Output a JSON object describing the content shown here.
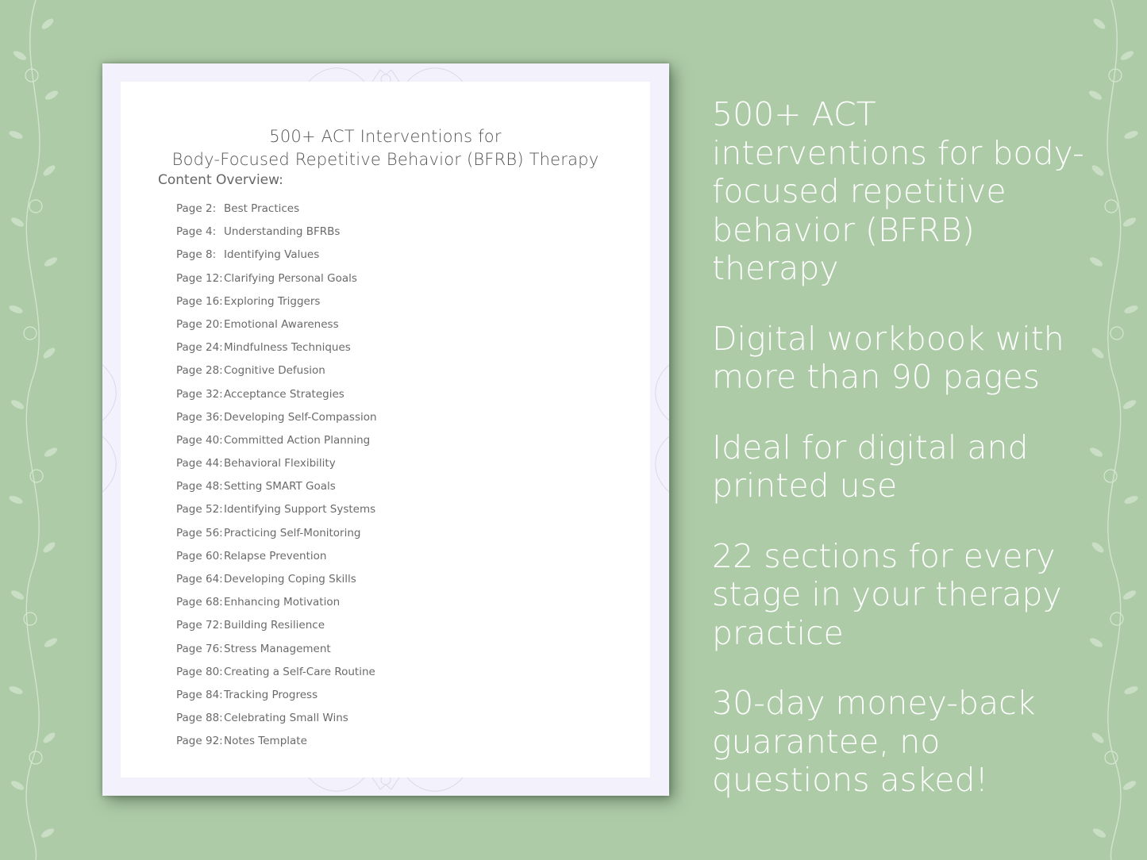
{
  "document": {
    "title_line1": "500+ ACT Interventions for",
    "title_line2": "Body-Focused Repetitive Behavior (BFRB) Therapy",
    "overview_label": "Content Overview:",
    "toc": [
      {
        "page": "Page  2:",
        "label": "Best Practices"
      },
      {
        "page": "Page  4:",
        "label": "Understanding BFRBs"
      },
      {
        "page": "Page  8:",
        "label": "Identifying Values"
      },
      {
        "page": "Page 12:",
        "label": "Clarifying Personal Goals"
      },
      {
        "page": "Page 16:",
        "label": "Exploring Triggers"
      },
      {
        "page": "Page 20:",
        "label": "Emotional Awareness"
      },
      {
        "page": "Page 24:",
        "label": "Mindfulness Techniques"
      },
      {
        "page": "Page 28:",
        "label": "Cognitive Defusion"
      },
      {
        "page": "Page 32:",
        "label": "Acceptance Strategies"
      },
      {
        "page": "Page 36:",
        "label": "Developing Self-Compassion"
      },
      {
        "page": "Page 40:",
        "label": "Committed Action Planning"
      },
      {
        "page": "Page 44:",
        "label": "Behavioral Flexibility"
      },
      {
        "page": "Page 48:",
        "label": "Setting SMART Goals"
      },
      {
        "page": "Page 52:",
        "label": "Identifying Support Systems"
      },
      {
        "page": "Page 56:",
        "label": "Practicing Self-Monitoring"
      },
      {
        "page": "Page 60:",
        "label": "Relapse Prevention"
      },
      {
        "page": "Page 64:",
        "label": "Developing Coping Skills"
      },
      {
        "page": "Page 68:",
        "label": "Enhancing Motivation"
      },
      {
        "page": "Page 72:",
        "label": "Building Resilience"
      },
      {
        "page": "Page 76:",
        "label": "Stress Management"
      },
      {
        "page": "Page 80:",
        "label": "Creating a Self-Care Routine"
      },
      {
        "page": "Page 84:",
        "label": "Tracking Progress"
      },
      {
        "page": "Page 88:",
        "label": "Celebrating Small Wins"
      },
      {
        "page": "Page 92:",
        "label": "Notes Template"
      }
    ]
  },
  "features": [
    "500+ ACT interventions for body-focused repetitive behavior (BFRB) therapy",
    "Digital workbook with more than 90 pages",
    "Ideal for digital and printed use",
    "22 sections for every stage in your therapy practice",
    "30-day money-back guarantee, no questions asked!"
  ],
  "colors": {
    "background": "#adcba7",
    "page_border": "#f3f1fb",
    "text_dark": "#555555",
    "feature_text": "#ffffff"
  }
}
